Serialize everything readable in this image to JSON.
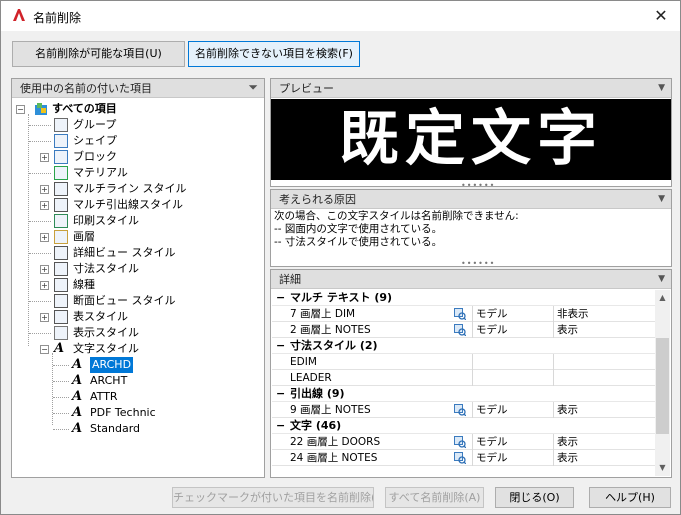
{
  "window": {
    "title": "名前削除"
  },
  "tabs": [
    {
      "label": "名前削除が可能な項目(U)",
      "selected": false
    },
    {
      "label": "名前削除できない項目を検索(F)",
      "selected": true
    }
  ],
  "tree": {
    "header": "使用中の名前の付いた項目",
    "root": "すべての項目",
    "items": [
      {
        "label": "グループ",
        "expandable": false
      },
      {
        "label": "シェイプ",
        "expandable": false
      },
      {
        "label": "ブロック",
        "expandable": true
      },
      {
        "label": "マテリアル",
        "expandable": false
      },
      {
        "label": "マルチライン スタイル",
        "expandable": true
      },
      {
        "label": "マルチ引出線スタイル",
        "expandable": true
      },
      {
        "label": "印刷スタイル",
        "expandable": false
      },
      {
        "label": "画層",
        "expandable": true
      },
      {
        "label": "詳細ビュー スタイル",
        "expandable": false
      },
      {
        "label": "寸法スタイル",
        "expandable": true
      },
      {
        "label": "線種",
        "expandable": true
      },
      {
        "label": "断面ビュー スタイル",
        "expandable": false
      },
      {
        "label": "表スタイル",
        "expandable": true
      },
      {
        "label": "表示スタイル",
        "expandable": false
      },
      {
        "label": "文字スタイル",
        "expandable": true,
        "expanded": true
      }
    ],
    "children": [
      {
        "label": "ARCHD",
        "selected": true
      },
      {
        "label": "ARCHT",
        "selected": false
      },
      {
        "label": "ATTR",
        "selected": false
      },
      {
        "label": "PDF Technic",
        "selected": false
      },
      {
        "label": "Standard",
        "selected": false
      }
    ]
  },
  "preview": {
    "header": "プレビュー",
    "text": "既定文字"
  },
  "reason": {
    "header": "考えられる原因",
    "lines": [
      "次の場合、この文字スタイルは名前削除できません:",
      "-- 図面内の文字で使用されている。",
      "-- 寸法スタイルで使用されている。"
    ]
  },
  "details": {
    "header": "詳細",
    "groups": [
      {
        "title": "マルチ テキスト (9)",
        "rows": [
          {
            "name": "7 画層上 DIM",
            "icon": true,
            "space": "モデル",
            "visibility": "非表示"
          },
          {
            "name": "2 画層上 NOTES",
            "icon": true,
            "space": "モデル",
            "visibility": "表示"
          }
        ]
      },
      {
        "title": "寸法スタイル (2)",
        "rows": [
          {
            "name": "EDIM",
            "icon": false,
            "space": "",
            "visibility": ""
          },
          {
            "name": "LEADER",
            "icon": false,
            "space": "",
            "visibility": ""
          }
        ]
      },
      {
        "title": "引出線 (9)",
        "rows": [
          {
            "name": "9 画層上 NOTES",
            "icon": true,
            "space": "モデル",
            "visibility": "表示"
          }
        ]
      },
      {
        "title": "文字 (46)",
        "rows": [
          {
            "name": "22 画層上 DOORS",
            "icon": true,
            "space": "モデル",
            "visibility": "表示"
          },
          {
            "name": "24 画層上 NOTES",
            "icon": true,
            "space": "モデル",
            "visibility": "表示"
          }
        ]
      }
    ]
  },
  "footer": {
    "purge_checked": "チェックマークが付いた項目を名前削除(P)",
    "purge_all": "すべて名前削除(A)",
    "close": "閉じる(O)",
    "help": "ヘルプ(H)"
  },
  "colors": {
    "accent": "#0078d7",
    "preview_bg": "#000000",
    "preview_fg": "#ffffff"
  }
}
